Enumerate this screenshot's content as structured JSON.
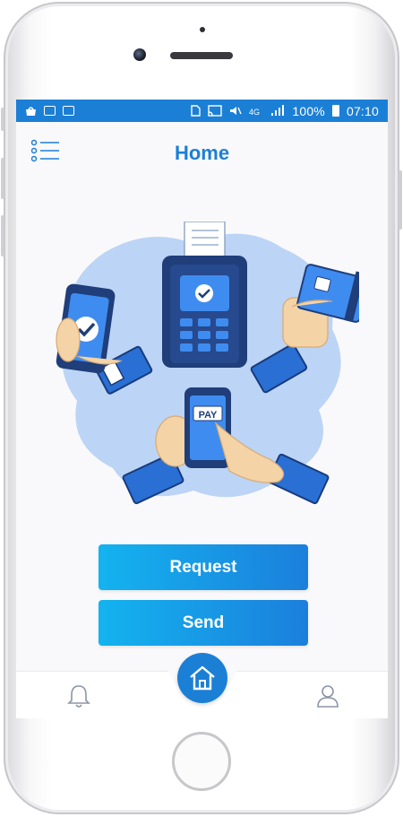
{
  "status_bar": {
    "battery_percent": "100%",
    "time": "07:10",
    "left_icons": [
      "bag-icon",
      "wifi-icon",
      "badge-icon"
    ],
    "right_icons": [
      "sim-icon",
      "cast-icon",
      "mute-icon",
      "network-4g-icon",
      "signal-icon",
      "battery-icon"
    ]
  },
  "header": {
    "title": "Home"
  },
  "illustration": {
    "pay_label": "PAY"
  },
  "actions": {
    "request_label": "Request",
    "send_label": "Send"
  },
  "bottom_nav": {
    "items": [
      "bell-icon",
      "home-icon",
      "user-icon"
    ]
  },
  "colors": {
    "primary": "#1c7fd6",
    "accent_light": "#14b3ef",
    "blob": "#bcd4f5"
  }
}
